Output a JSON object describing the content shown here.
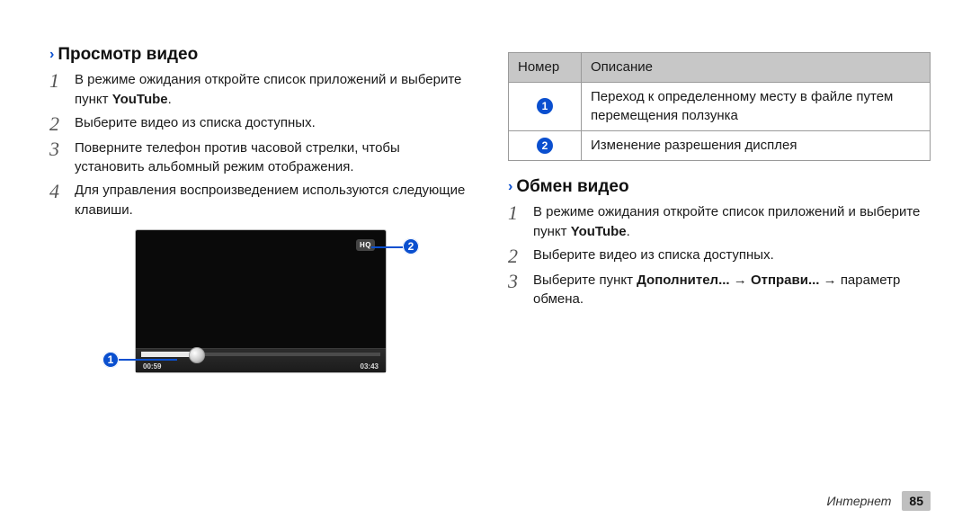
{
  "left": {
    "heading": "Просмотр видео",
    "steps": [
      {
        "n": "1",
        "pre": "В режиме ожидания откройте список приложений и выберите пункт ",
        "bold": "YouTube",
        "post": "."
      },
      {
        "n": "2",
        "text": "Выберите видео из списка доступных."
      },
      {
        "n": "3",
        "text": "Поверните телефон против часовой стрелки, чтобы установить альбомный режим отображения."
      },
      {
        "n": "4",
        "text": "Для управления воспроизведением используются следующие клавиши."
      }
    ],
    "player": {
      "hq": "HQ",
      "time_current": "00:59",
      "time_total": "03:43"
    },
    "callouts": {
      "c1": "1",
      "c2": "2"
    }
  },
  "right": {
    "table": {
      "headers": {
        "num": "Номер",
        "desc": "Описание"
      },
      "rows": [
        {
          "n": "1",
          "desc": "Переход к определенному месту в файле путем перемещения ползунка"
        },
        {
          "n": "2",
          "desc": "Изменение разрешения дисплея"
        }
      ]
    },
    "heading": "Обмен видео",
    "steps": [
      {
        "n": "1",
        "pre": "В режиме ожидания откройте список приложений и выберите пункт ",
        "bold": "YouTube",
        "post": "."
      },
      {
        "n": "2",
        "text": "Выберите видео из списка доступных."
      },
      {
        "n": "3",
        "pre": "Выберите пункт ",
        "bold1": "Дополнител...",
        "arrow1": " → ",
        "bold2": "Отправи...",
        "arrow2": " → ",
        "post": "параметр обмена."
      }
    ]
  },
  "footer": {
    "section": "Интернет",
    "page": "85"
  }
}
